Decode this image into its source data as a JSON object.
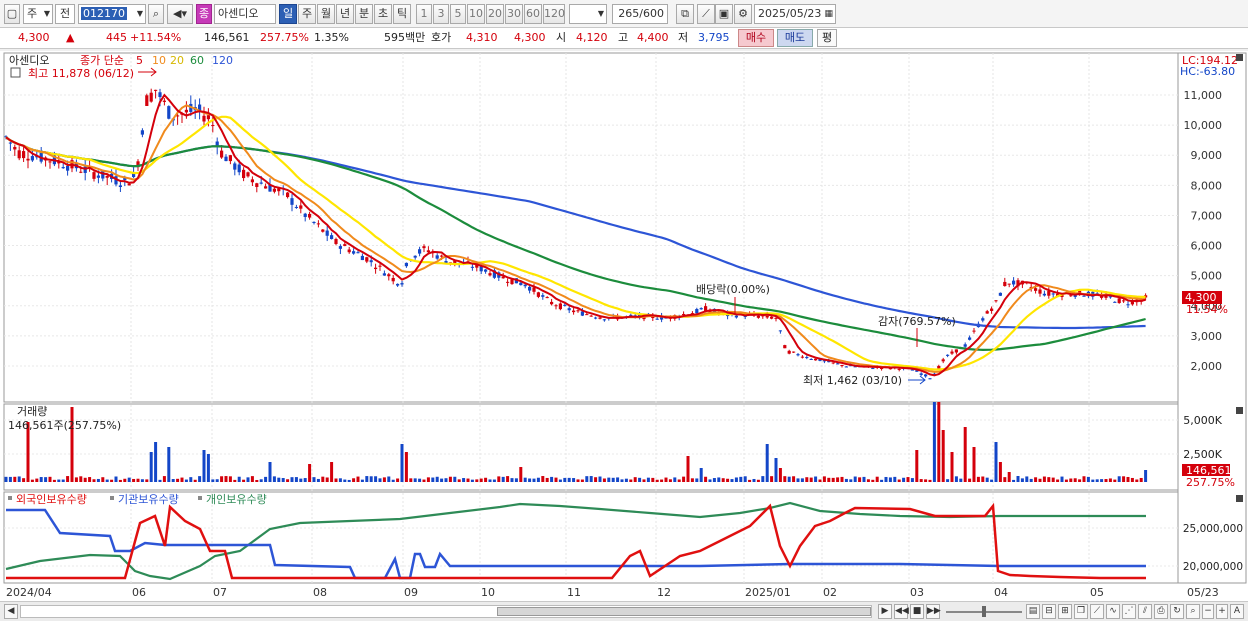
{
  "toolbar": {
    "period_mode": "주",
    "prev_label": "전",
    "code": "012170",
    "type_badge": "종",
    "name": "아센디오",
    "tabs": [
      "일",
      "주",
      "월",
      "년",
      "분",
      "초",
      "틱"
    ],
    "active_tab": "일",
    "intervals": [
      "1",
      "3",
      "5",
      "10",
      "20",
      "30",
      "60",
      "120"
    ],
    "count": "265",
    "count_total": "/600",
    "date": "2025/05/23"
  },
  "info": {
    "price": "4,300",
    "change": "445",
    "change_pct": "+11.54%",
    "volume": "146,561",
    "volume_pct": "257.75%",
    "turnover_pct": "1.35%",
    "trade_value": "595백만",
    "ask_label": "호가",
    "ask1": "4,310",
    "ask2": "4,300",
    "open_label": "시",
    "open": "4,120",
    "high_label": "고",
    "high": "4,400",
    "low_label": "저",
    "low": "3,795",
    "buy_label": "매수",
    "sell_label": "매도",
    "flat_label": "평"
  },
  "price_panel": {
    "stock_label": "아센디오",
    "ma_label": "종가 단순",
    "ma_periods": [
      "5",
      "10",
      "20",
      "60",
      "120"
    ],
    "high_marker": "최고 11,878 (06/12)",
    "low_marker": "최저 1,462 (03/10)",
    "dividend_marker": "배당락(0.00%)",
    "reduction_marker": "감자(769.57%)",
    "lc": "LC:194.12",
    "hc": "HC:-63.80",
    "y_ticks": [
      "11,000",
      "10,000",
      "9,000",
      "8,000",
      "7,000",
      "6,000",
      "5,000",
      "4,000",
      "3,000",
      "2,000"
    ],
    "price_tag": "4,300",
    "price_tag_pct": "11.54%"
  },
  "volume_panel": {
    "title": "거래량",
    "value_line": "146,561주(257.75%)",
    "y_ticks": [
      "5,000K",
      "2,500K"
    ],
    "tag_value": "146,561",
    "tag_pct": "257.75%"
  },
  "holding_panel": {
    "legend": [
      "외국인보유수량",
      "기관보유수량",
      "개인보유수량"
    ],
    "y_ticks": [
      "25,000,000",
      "20,000,000"
    ]
  },
  "x_axis": [
    "2024/04",
    "06",
    "07",
    "08",
    "09",
    "10",
    "11",
    "12",
    "2025/01",
    "02",
    "03",
    "04",
    "05",
    "05/23"
  ],
  "colors": {
    "up": "#d4000b",
    "down": "#1346c8",
    "ma5": "#d4000b",
    "ma10": "#f08a1c",
    "ma20": "#ffe600",
    "ma60": "#1c8c3c",
    "ma120": "#2d55d6",
    "foreign": "#e01010",
    "institution": "#2d55d6",
    "individual": "#2e8b57"
  }
}
